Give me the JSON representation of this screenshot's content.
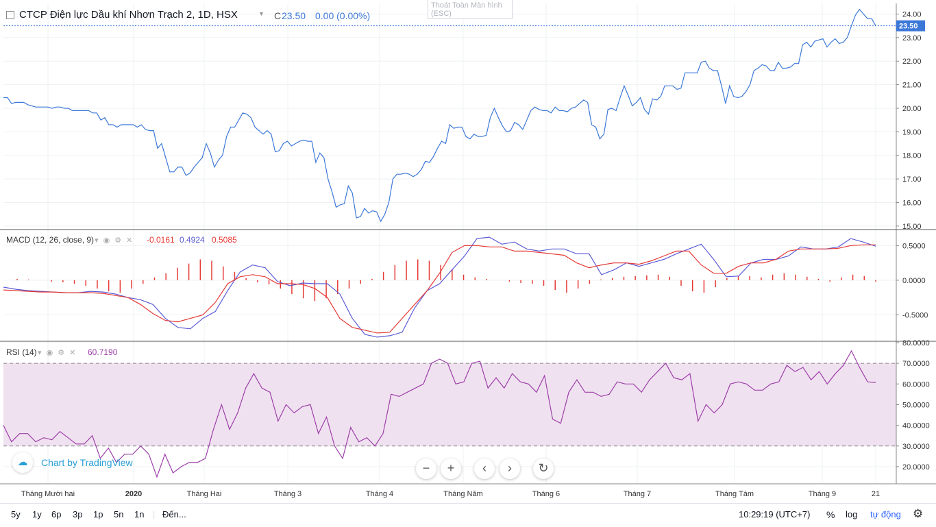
{
  "header": {
    "symbol": "CTCP Điện lực Dầu khí Nhơn Trạch 2, 1D, HSX",
    "close_prefix": "C",
    "close_value": "23.50",
    "change": "0.00 (0.00%)",
    "fullscreen_tip": "Thoát Toàn Màn hình",
    "fullscreen_key": "(ESC)"
  },
  "chart_data": [
    {
      "type": "line",
      "title": "CTCP Điện lực Dầu khí Nhơn Trạch 2, 1D, HSX",
      "x_ticks": [
        "Tháng Mười hai",
        "2020",
        "Tháng Hai",
        "Tháng 3",
        "Tháng 4",
        "Tháng Năm",
        "Tháng 6",
        "Tháng 7",
        "Tháng Tám",
        "Tháng 9",
        "21"
      ],
      "y_ticks": [
        "15.00",
        "16.00",
        "17.00",
        "18.00",
        "19.00",
        "20.00",
        "21.00",
        "22.00",
        "23.00",
        "24.00"
      ],
      "ylim": [
        14.85,
        24.45
      ],
      "last_value_label": "23.50",
      "series": [
        {
          "color": "#3c78d8",
          "values": [
            20.45,
            20.45,
            20.2,
            20.25,
            20.25,
            20.25,
            20.15,
            20.1,
            20.05,
            20.05,
            20.05,
            20.05,
            20,
            20.05,
            20.05,
            20,
            20,
            19.9,
            19.9,
            19.9,
            19.9,
            19.9,
            19.8,
            19.8,
            19.5,
            19.6,
            19.3,
            19.3,
            19.2,
            19.3,
            19.3,
            19.3,
            19.3,
            19.2,
            19.3,
            19.1,
            19.05,
            19.05,
            18.3,
            18.5,
            17.9,
            17.3,
            17.3,
            17.5,
            17.5,
            17.15,
            17.25,
            17.5,
            17.7,
            17.9,
            18.5,
            18.1,
            17.5,
            17.8,
            18,
            18.8,
            19.2,
            19.2,
            19.5,
            19.8,
            19.75,
            19.6,
            19.2,
            19.05,
            18.9,
            19.05,
            18.9,
            18.15,
            18.2,
            18.5,
            18.6,
            18.4,
            18.5,
            18.6,
            18.65,
            18.6,
            18.6,
            17.7,
            18.1,
            17.9,
            17.0,
            16.45,
            15.8,
            15.9,
            15.95,
            16.7,
            16.4,
            15.35,
            15.4,
            15.75,
            15.55,
            15.65,
            15.6,
            15.2,
            15.5,
            16.0,
            17.0,
            17.2,
            17.2,
            17.25,
            17.2,
            17.1,
            17.2,
            17.4,
            17.75,
            17.7,
            17.95,
            18.3,
            18.6,
            18.5,
            19.3,
            19.15,
            19.2,
            19.2,
            18.8,
            18.7,
            18.9,
            18.8,
            18.8,
            18.85,
            19.6,
            20.0,
            19.6,
            19.25,
            19.0,
            19.05,
            19.4,
            19.3,
            19.1,
            19.5,
            19.9,
            20.05,
            19.95,
            19.9,
            19.9,
            19.8,
            20.05,
            19.9,
            19.9,
            19.85,
            20.0,
            20.05,
            20.2,
            20.35,
            20.25,
            19.3,
            19.2,
            18.7,
            18.9,
            19.95,
            20.0,
            19.9,
            20.45,
            20.95,
            20.55,
            20.1,
            20.25,
            20.45,
            19.95,
            19.75,
            20.4,
            20.35,
            20.5,
            20.95,
            20.95,
            20.95,
            20.8,
            20.85,
            21.5,
            21.5,
            21.5,
            21.5,
            21.95,
            22.0,
            21.7,
            21.6,
            21.6,
            20.95,
            20.2,
            20.95,
            20.5,
            20.45,
            20.5,
            20.7,
            21.0,
            21.6,
            21.7,
            21.85,
            21.8,
            21.6,
            21.6,
            21.95,
            21.7,
            21.7,
            21.75,
            21.9,
            21.9,
            22.7,
            22.8,
            22.6,
            22.85,
            22.9,
            22.95,
            22.6,
            22.8,
            22.95,
            22.75,
            22.8,
            23.0,
            23.5,
            23.95,
            24.2,
            24.0,
            23.8,
            23.8,
            23.5
          ]
        }
      ]
    },
    {
      "type": "line",
      "title": "MACD (12, 26, close, 9)",
      "legend": [
        "-0.0161",
        "0.4924",
        "0.5085"
      ],
      "y_ticks": [
        "0.5000",
        "0.0000",
        "-0.5000"
      ],
      "ylim": [
        -0.88,
        0.72
      ],
      "series": [
        {
          "color": "#5b5bd6",
          "values": [
            -0.1,
            -0.13,
            -0.15,
            -0.16,
            -0.17,
            -0.18,
            -0.18,
            -0.16,
            -0.17,
            -0.2,
            -0.25,
            -0.28,
            -0.35,
            -0.55,
            -0.68,
            -0.7,
            -0.55,
            -0.45,
            -0.15,
            0.12,
            0.22,
            0.18,
            -0.02,
            -0.08,
            -0.04,
            -0.05,
            -0.05,
            -0.2,
            -0.55,
            -0.78,
            -0.82,
            -0.8,
            -0.75,
            -0.4,
            -0.15,
            -0.05,
            0.15,
            0.35,
            0.6,
            0.62,
            0.52,
            0.55,
            0.45,
            0.42,
            0.45,
            0.45,
            0.38,
            0.38,
            0.08,
            0.15,
            0.25,
            0.2,
            0.25,
            0.3,
            0.38,
            0.45,
            0.52,
            0.3,
            0.05,
            0.06,
            0.25,
            0.3,
            0.3,
            0.35,
            0.48,
            0.45,
            0.45,
            0.48,
            0.6,
            0.55,
            0.49
          ]
        },
        {
          "color": "#e53935",
          "values": [
            -0.14,
            -0.15,
            -0.16,
            -0.17,
            -0.17,
            -0.18,
            -0.18,
            -0.18,
            -0.19,
            -0.22,
            -0.25,
            -0.35,
            -0.48,
            -0.58,
            -0.6,
            -0.55,
            -0.5,
            -0.32,
            -0.05,
            0.05,
            0.08,
            0.05,
            -0.05,
            -0.05,
            -0.06,
            -0.12,
            -0.25,
            -0.55,
            -0.68,
            -0.72,
            -0.76,
            -0.75,
            -0.55,
            -0.35,
            -0.15,
            0.1,
            0.4,
            0.5,
            0.5,
            0.48,
            0.48,
            0.42,
            0.42,
            0.4,
            0.38,
            0.36,
            0.25,
            0.18,
            0.22,
            0.25,
            0.25,
            0.23,
            0.28,
            0.35,
            0.42,
            0.42,
            0.22,
            0.1,
            0.1,
            0.2,
            0.25,
            0.25,
            0.3,
            0.42,
            0.45,
            0.45,
            0.45,
            0.46,
            0.5,
            0.51,
            0.51
          ]
        }
      ],
      "histogram_color": "#e53935",
      "histogram": [
        0.02,
        0.01,
        0.0,
        -0.02,
        -0.03,
        -0.05,
        -0.08,
        -0.12,
        -0.16,
        -0.18,
        -0.12,
        -0.05,
        0.04,
        0.1,
        0.18,
        0.24,
        0.3,
        0.28,
        0.2,
        0.12,
        0.03,
        -0.03,
        -0.06,
        -0.12,
        -0.2,
        -0.26,
        -0.3,
        -0.26,
        -0.2,
        -0.12,
        -0.05,
        0.02,
        0.12,
        0.22,
        0.28,
        0.3,
        0.28,
        0.22,
        0.16,
        0.08,
        0.04,
        0.02,
        0.0,
        -0.02,
        -0.04,
        -0.05,
        -0.08,
        -0.14,
        -0.18,
        -0.12,
        -0.05,
        0.01,
        0.03,
        0.05,
        0.06,
        0.07,
        0.08,
        0.05,
        -0.08,
        -0.16,
        -0.18,
        -0.1,
        0.03,
        0.06,
        0.06,
        0.04,
        0.08,
        0.1,
        0.08,
        0.05,
        0.02,
        -0.02,
        0.04,
        0.08,
        0.06,
        -0.02
      ]
    },
    {
      "type": "line",
      "title": "RSI (14)",
      "legend": [
        "60.7190"
      ],
      "y_ticks": [
        "80.0000",
        "70.0000",
        "60.0000",
        "50.0000",
        "40.0000",
        "30.0000",
        "20.0000"
      ],
      "ylim": [
        11.7,
        80.3
      ],
      "band": [
        30,
        70
      ],
      "series": [
        {
          "color": "#9c3fa8",
          "values": [
            40,
            32,
            36,
            36,
            32,
            34,
            33,
            37,
            34,
            31,
            31,
            35,
            24,
            29,
            22,
            26,
            26,
            30,
            26,
            15,
            26,
            17,
            20,
            22,
            22,
            24,
            38,
            50,
            38,
            46,
            58,
            65,
            58,
            56,
            42,
            50,
            46,
            49,
            50,
            36,
            44,
            30,
            24,
            39,
            32,
            34,
            30,
            36,
            55,
            54,
            56,
            58,
            60,
            70,
            72,
            70,
            60,
            61,
            70,
            71,
            58,
            63,
            58,
            65,
            61,
            60,
            56,
            64,
            43,
            41,
            56,
            62,
            56,
            56,
            54,
            55,
            61,
            60,
            60,
            56,
            62,
            66,
            70,
            63,
            62,
            65,
            42,
            50,
            46,
            50,
            60,
            61,
            60,
            57,
            57,
            60,
            61,
            69,
            66,
            68,
            62,
            66,
            60,
            65,
            69,
            76,
            68,
            61,
            60.7
          ]
        }
      ]
    }
  ],
  "watermark": "Chart by TradingView",
  "nav": {
    "zoom_out": "−",
    "zoom_in": "+",
    "scroll_left": "‹",
    "scroll_right": "›",
    "reset": "↻"
  },
  "timeframes": [
    "5y",
    "1y",
    "6p",
    "3p",
    "1p",
    "5n",
    "1n"
  ],
  "goto": "Đến...",
  "time": "10:29:19 (UTC+7)",
  "percent": "%",
  "log": "log",
  "auto": "tự động",
  "settings_icon": "gear-icon",
  "colors": {
    "price_line": "#3c78d8",
    "rsi_line": "#9c3fa8",
    "rsi_band": "#f0e1f0",
    "grid": "#eef0f3",
    "price_label_bg": "#3c78d8"
  }
}
